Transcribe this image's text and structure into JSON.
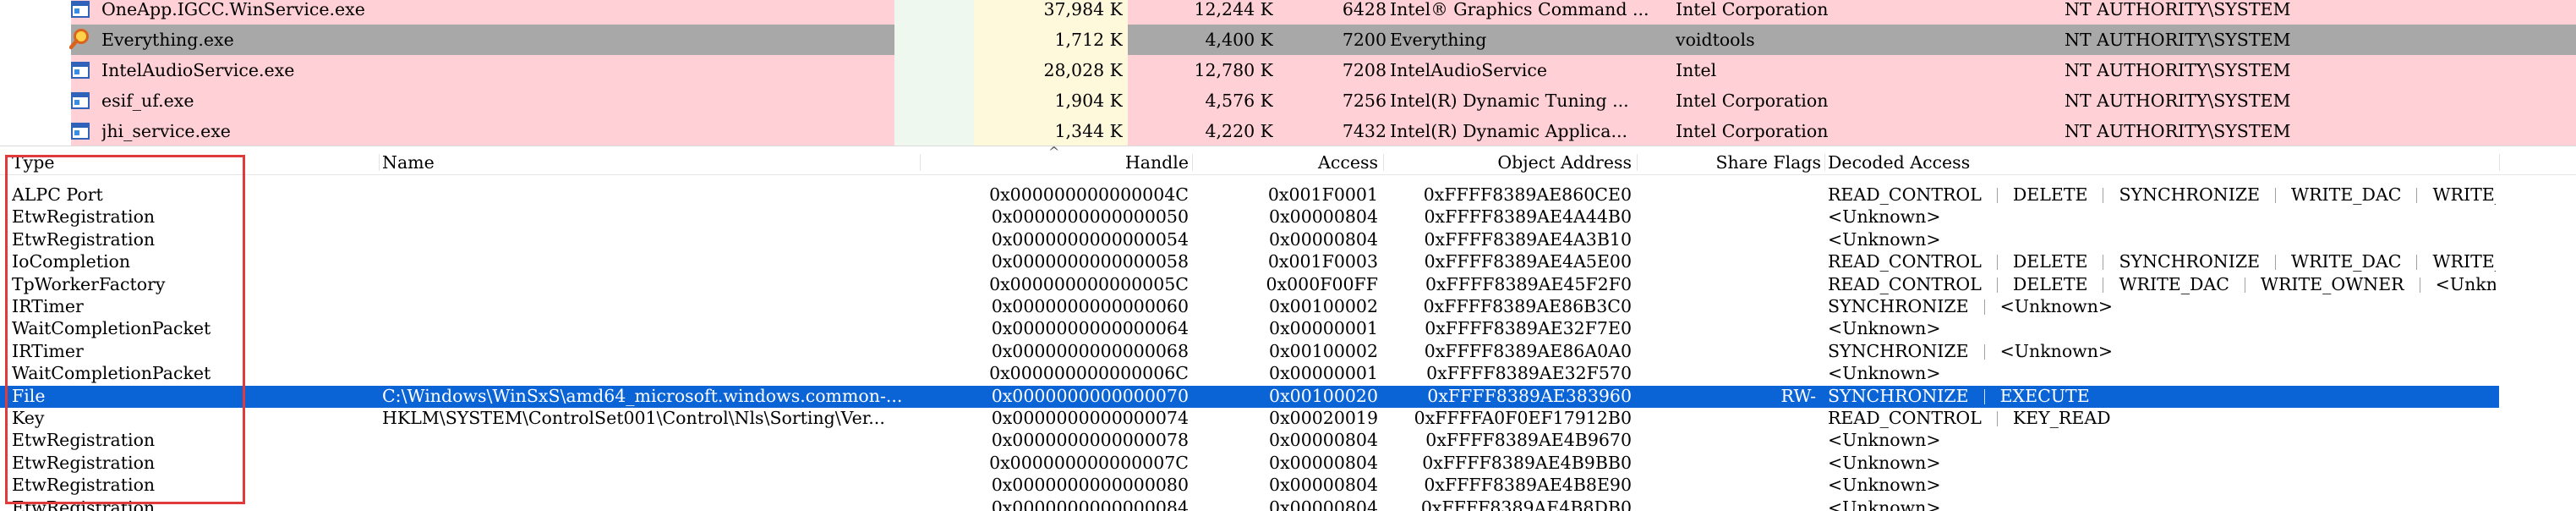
{
  "processes": [
    {
      "name": "OneApp.IGCC.WinService.exe",
      "private": "37,984 K",
      "working": "12,244 K",
      "pid": "6428",
      "desc": "Intel® Graphics Command ...",
      "company": "Intel Corporation",
      "user": "NT AUTHORITY\\SYSTEM",
      "bg": "#ffd0d5",
      "icon": "service-window-icon",
      "selected": false
    },
    {
      "name": "Everything.exe",
      "private": "1,712 K",
      "working": "4,400 K",
      "pid": "7200",
      "desc": "Everything",
      "company": "voidtools",
      "user": "NT AUTHORITY\\SYSTEM",
      "bg": "#a8a8a8",
      "icon": "magnifier-app-icon",
      "selected": true
    },
    {
      "name": "IntelAudioService.exe",
      "private": "28,028 K",
      "working": "12,780 K",
      "pid": "7208",
      "desc": "IntelAudioService",
      "company": "Intel",
      "user": "NT AUTHORITY\\SYSTEM",
      "bg": "#ffd0d5",
      "icon": "service-window-icon",
      "selected": false
    },
    {
      "name": "esif_uf.exe",
      "private": "1,904 K",
      "working": "4,576 K",
      "pid": "7256",
      "desc": "Intel(R) Dynamic Tuning ...",
      "company": "Intel Corporation",
      "user": "NT AUTHORITY\\SYSTEM",
      "bg": "#ffd0d5",
      "icon": "service-window-icon",
      "selected": false
    },
    {
      "name": "jhi_service.exe",
      "private": "1,344 K",
      "working": "4,220 K",
      "pid": "7432",
      "desc": "Intel(R) Dynamic Applica...",
      "company": "Intel Corporation",
      "user": "NT AUTHORITY\\SYSTEM",
      "bg": "#ffd0d5",
      "icon": "service-window-icon",
      "selected": false
    }
  ],
  "handles_header": {
    "type": "Type",
    "name": "Name",
    "handle": "Handle",
    "access": "Access",
    "object_address": "Object Address",
    "share_flags": "Share Flags",
    "decoded_access": "Decoded Access",
    "sort_indicator": "^"
  },
  "handles": [
    {
      "type": "ALPC Port",
      "name": "",
      "handle": "0x000000000000004C",
      "access": "0x001F0001",
      "object": "0xFFFF8389AE860CE0",
      "share": "",
      "decoded": [
        "READ_CONTROL",
        "DELETE",
        "SYNCHRONIZE",
        "WRITE_DAC",
        "WRITE_OWNER ..."
      ],
      "selected": false
    },
    {
      "type": "EtwRegistration",
      "name": "",
      "handle": "0x0000000000000050",
      "access": "0x00000804",
      "object": "0xFFFF8389AE4A44B0",
      "share": "",
      "decoded": [
        "<Unknown>"
      ],
      "selected": false
    },
    {
      "type": "EtwRegistration",
      "name": "",
      "handle": "0x0000000000000054",
      "access": "0x00000804",
      "object": "0xFFFF8389AE4A3B10",
      "share": "",
      "decoded": [
        "<Unknown>"
      ],
      "selected": false
    },
    {
      "type": "IoCompletion",
      "name": "",
      "handle": "0x0000000000000058",
      "access": "0x001F0003",
      "object": "0xFFFF8389AE4A5E00",
      "share": "",
      "decoded": [
        "READ_CONTROL",
        "DELETE",
        "SYNCHRONIZE",
        "WRITE_DAC",
        "WRITE_OWNER ..."
      ],
      "selected": false
    },
    {
      "type": "TpWorkerFactory",
      "name": "",
      "handle": "0x000000000000005C",
      "access": "0x000F00FF",
      "object": "0xFFFF8389AE45F2F0",
      "share": "",
      "decoded": [
        "READ_CONTROL",
        "DELETE",
        "WRITE_DAC",
        "WRITE_OWNER",
        "<Unknown>"
      ],
      "selected": false
    },
    {
      "type": "IRTimer",
      "name": "",
      "handle": "0x0000000000000060",
      "access": "0x00100002",
      "object": "0xFFFF8389AE86B3C0",
      "share": "",
      "decoded": [
        "SYNCHRONIZE",
        "<Unknown>"
      ],
      "selected": false
    },
    {
      "type": "WaitCompletionPacket",
      "name": "",
      "handle": "0x0000000000000064",
      "access": "0x00000001",
      "object": "0xFFFF8389AE32F7E0",
      "share": "",
      "decoded": [
        "<Unknown>"
      ],
      "selected": false
    },
    {
      "type": "IRTimer",
      "name": "",
      "handle": "0x0000000000000068",
      "access": "0x00100002",
      "object": "0xFFFF8389AE86A0A0",
      "share": "",
      "decoded": [
        "SYNCHRONIZE",
        "<Unknown>"
      ],
      "selected": false
    },
    {
      "type": "WaitCompletionPacket",
      "name": "",
      "handle": "0x000000000000006C",
      "access": "0x00000001",
      "object": "0xFFFF8389AE32F570",
      "share": "",
      "decoded": [
        "<Unknown>"
      ],
      "selected": false
    },
    {
      "type": "File",
      "name": "C:\\Windows\\WinSxS\\amd64_microsoft.windows.common-...",
      "handle": "0x0000000000000070",
      "access": "0x00100020",
      "object": "0xFFFF8389AE383960",
      "share": "RW-",
      "decoded": [
        "SYNCHRONIZE",
        "EXECUTE"
      ],
      "selected": true
    },
    {
      "type": "Key",
      "name": "HKLM\\SYSTEM\\ControlSet001\\Control\\Nls\\Sorting\\Ver...",
      "handle": "0x0000000000000074",
      "access": "0x00020019",
      "object": "0xFFFFA0F0EF17912B0",
      "share": "",
      "decoded": [
        "READ_CONTROL",
        "KEY_READ"
      ],
      "selected": false
    },
    {
      "type": "EtwRegistration",
      "name": "",
      "handle": "0x0000000000000078",
      "access": "0x00000804",
      "object": "0xFFFF8389AE4B9670",
      "share": "",
      "decoded": [
        "<Unknown>"
      ],
      "selected": false
    },
    {
      "type": "EtwRegistration",
      "name": "",
      "handle": "0x000000000000007C",
      "access": "0x00000804",
      "object": "0xFFFF8389AE4B9BB0",
      "share": "",
      "decoded": [
        "<Unknown>"
      ],
      "selected": false
    },
    {
      "type": "EtwRegistration",
      "name": "",
      "handle": "0x0000000000000080",
      "access": "0x00000804",
      "object": "0xFFFF8389AE4B8E90",
      "share": "",
      "decoded": [
        "<Unknown>"
      ],
      "selected": false
    },
    {
      "type": "EtwRegistration",
      "name": "",
      "handle": "0x0000000000000084",
      "access": "0x00000804",
      "object": "0xFFFF8389AE4B8DB0",
      "share": "",
      "decoded": [
        "<Unknown>"
      ],
      "selected": false
    }
  ],
  "colors": {
    "service_row": "#ffd0d5",
    "selected_process_row": "#a8a8a8",
    "selected_handle_row": "#0a64d6",
    "selected_handle_text": "#ffffff",
    "private_bytes_column": "#fff9dc",
    "cpu_column": "#eef8ee",
    "annotation_box": "#e03a3a"
  }
}
